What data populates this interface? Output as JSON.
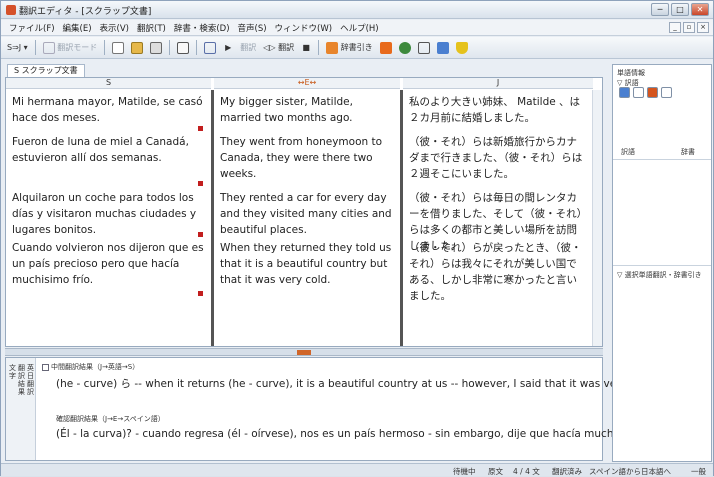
{
  "window": {
    "title": "翻訳エディタ - [スクラップ文書]",
    "buttons": [
      "─",
      "□",
      "✕"
    ]
  },
  "menu": {
    "items": [
      "ファイル(F)",
      "編集(E)",
      "表示(V)",
      "翻訳(T)",
      "辞書・検索(D)",
      "音声(S)",
      "ウィンドウ(W)",
      "ヘルプ(H)"
    ],
    "mdi_buttons": [
      "_",
      "▫",
      "×"
    ]
  },
  "toolbar": {
    "lang_label": "S⇒J ▾",
    "dis1": "翻訳モード",
    "dis2": "翻訳",
    "bunpou": "翻訳",
    "speech": "◁▷ 翻訳",
    "dictreg": "辞書引き",
    "colors": {
      "lang": "#3a6fd1",
      "translate": "#1f7a2a",
      "doc": "#f4f4f4",
      "orange": "#e8852c",
      "green": "#2e9a3a",
      "yellow": "#e5c21c"
    }
  },
  "doc_tab": {
    "label": "S スクラップ文書"
  },
  "editor": {
    "headers": [
      "S",
      "↔E↔",
      "J"
    ],
    "rows": [
      {
        "s": "Mi hermana mayor, Matilde, se casó hace dos meses.",
        "e": "My bigger sister, Matilde, married two months ago.",
        "j": "私のより大きい姉妹、 Matilde 、は２カ月前に結婚しました。",
        "n": "1"
      },
      {
        "s": "Fueron de luna de miel a Canadá, estuvieron allí dos semanas.",
        "e": "They went from honeymoon to Canada, they were there two weeks.",
        "j": "（彼・それ）らは新婚旅行からカナダまで行きました、（彼・それ）らは２週そこにいました。",
        "n": "2"
      },
      {
        "s": "Alquilaron un coche para todos los días y visitaron muchas ciudades y lugares bonitos.",
        "e": "They rented a car for every day and they visited many cities and beautiful places.",
        "j": "（彼・それ）らは毎日の間レンタカーを借りました、そして（彼・それ）らは多くの都市と美しい場所を訪問しました。",
        "n": "3"
      },
      {
        "s": "Cuando volvieron nos dijeron que es un país precioso pero que hacía muchisimo frío.",
        "e": "When they returned they told us that it is a beautiful country but that it was very cold.",
        "j": "（彼・それ）らが戻ったとき、（彼・それ）らは我々にそれが美しい国である、しかし非常に寒かったと言いました。",
        "n": "4"
      }
    ]
  },
  "lower": {
    "side_labels": [
      "文字",
      "翻訳結果",
      "英日翻訳"
    ],
    "sec1_title": "中間翻訳結果（J→英語→S）",
    "sec1_text": "(he - curve) ら -- when it returns (he - curve), it is a beautiful country at us -- however, I said that it was very cold.",
    "sec2_title": "確認翻訳結果（J→E→スペイン語）",
    "sec2_text": "(Él - la curva)? - cuando regresa (él - oírvese), nos es un país hermoso - sin embargo, dije que hacía mucho frío."
  },
  "right_panel": {
    "title": "単語情報",
    "sub": "▽ 訳語",
    "col1": "訳語",
    "col2": "辞書",
    "bottom": "▽ 選択単語翻訳・辞書引き"
  },
  "status": {
    "mode": "待機中",
    "doc": "原文",
    "count": "4 / 4 文",
    "state": "翻訳済み",
    "direction": "スペイン語から日本語へ",
    "kind": "一般"
  }
}
